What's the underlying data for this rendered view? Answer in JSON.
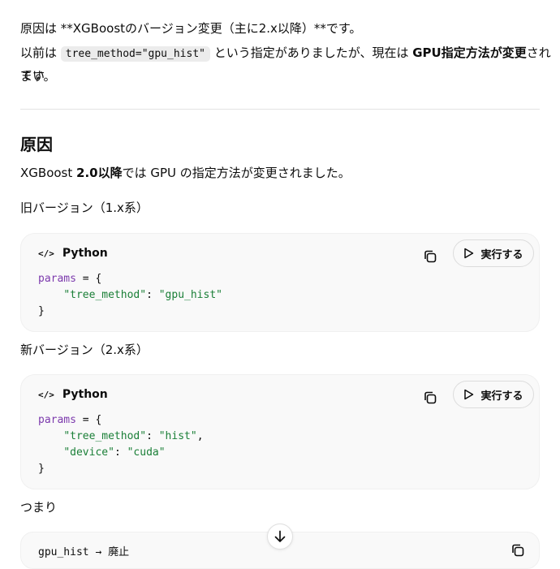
{
  "intro": {
    "line1": "原因は **XGBoostのバージョン変更（主に2.x以降）**です。",
    "line2_a": "以前は ",
    "line2_code": "tree_method=\"gpu_hist\"",
    "line2_b": " という指定がありましたが、現在は ",
    "line2_bold": "GPU指定方法が変更",
    "line2_c": "されてい",
    "line3": "ます。"
  },
  "section": {
    "heading": "原因",
    "text_a": "XGBoost ",
    "text_bold": "2.0以降",
    "text_b": "では GPU の指定方法が変更されました。"
  },
  "old_label": "旧バージョン（1.x系）",
  "new_label": "新バージョン（2.x系）",
  "codeblocks": [
    {
      "language": "Python",
      "run_label": "実行する",
      "lines": [
        {
          "kw": "params",
          "rest": " = {"
        },
        {
          "indent": "    ",
          "key": "\"tree_method\"",
          "sep": ": ",
          "val": "\"gpu_hist\"",
          "tail": ""
        },
        {
          "plain": "}"
        }
      ]
    },
    {
      "language": "Python",
      "run_label": "実行する",
      "lines": [
        {
          "kw": "params",
          "rest": " = {"
        },
        {
          "indent": "    ",
          "key": "\"tree_method\"",
          "sep": ": ",
          "val": "\"hist\"",
          "tail": ","
        },
        {
          "indent": "    ",
          "key": "\"device\"",
          "sep": ": ",
          "val": "\"cuda\"",
          "tail": ""
        },
        {
          "plain": "}"
        }
      ]
    }
  ],
  "summary_label": "つまり",
  "summary_code": "gpu_hist → 廃止",
  "colors": {
    "keyword": "#7c3aad",
    "string": "#1a7f37",
    "code_bg": "#f9f9f9"
  },
  "icons": {
    "code": "code-icon",
    "copy": "copy-icon",
    "play": "play-icon",
    "scroll": "arrow-down-icon"
  }
}
